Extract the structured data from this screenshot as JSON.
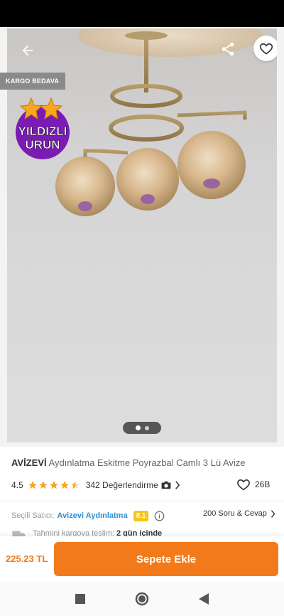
{
  "hero": {
    "cargo_badge": "KARGO BEDAVA",
    "badge_line1": "YILDIZLI",
    "badge_line2": "ÜRÜN",
    "active_slide": 1,
    "slide_count": 2
  },
  "product": {
    "brand": "AVİZEVİ",
    "name": "Aydınlatma Eskitme Poyrazbal Camlı 3 Lü Avize",
    "rating": "4.5",
    "rating_value": 4.5,
    "reviews_label": "342 Değerlendirme",
    "likes": "26B"
  },
  "seller": {
    "label": "Seçili Satıcı:",
    "name": "Avizevi Aydınlatma",
    "score": "8.1",
    "qa_label": "200 Soru & Cevap"
  },
  "delivery": {
    "label": "Tahmini kargoya teslim:",
    "value": "2 gün içinde"
  },
  "bottom": {
    "price": "225.23 TL",
    "cart_button": "Sepete Ekle"
  },
  "colors": {
    "accent": "#f27a1a",
    "star": "#f5a623",
    "seller_link": "#2a8ed4",
    "badge_purple": "#7a1bb3"
  },
  "icons": [
    "back-arrow-icon",
    "share-icon",
    "heart-icon",
    "star-icon",
    "camera-icon",
    "chevron-right-icon",
    "info-icon",
    "truck-icon",
    "nav-square-icon",
    "nav-circle-icon",
    "nav-triangle-icon"
  ]
}
